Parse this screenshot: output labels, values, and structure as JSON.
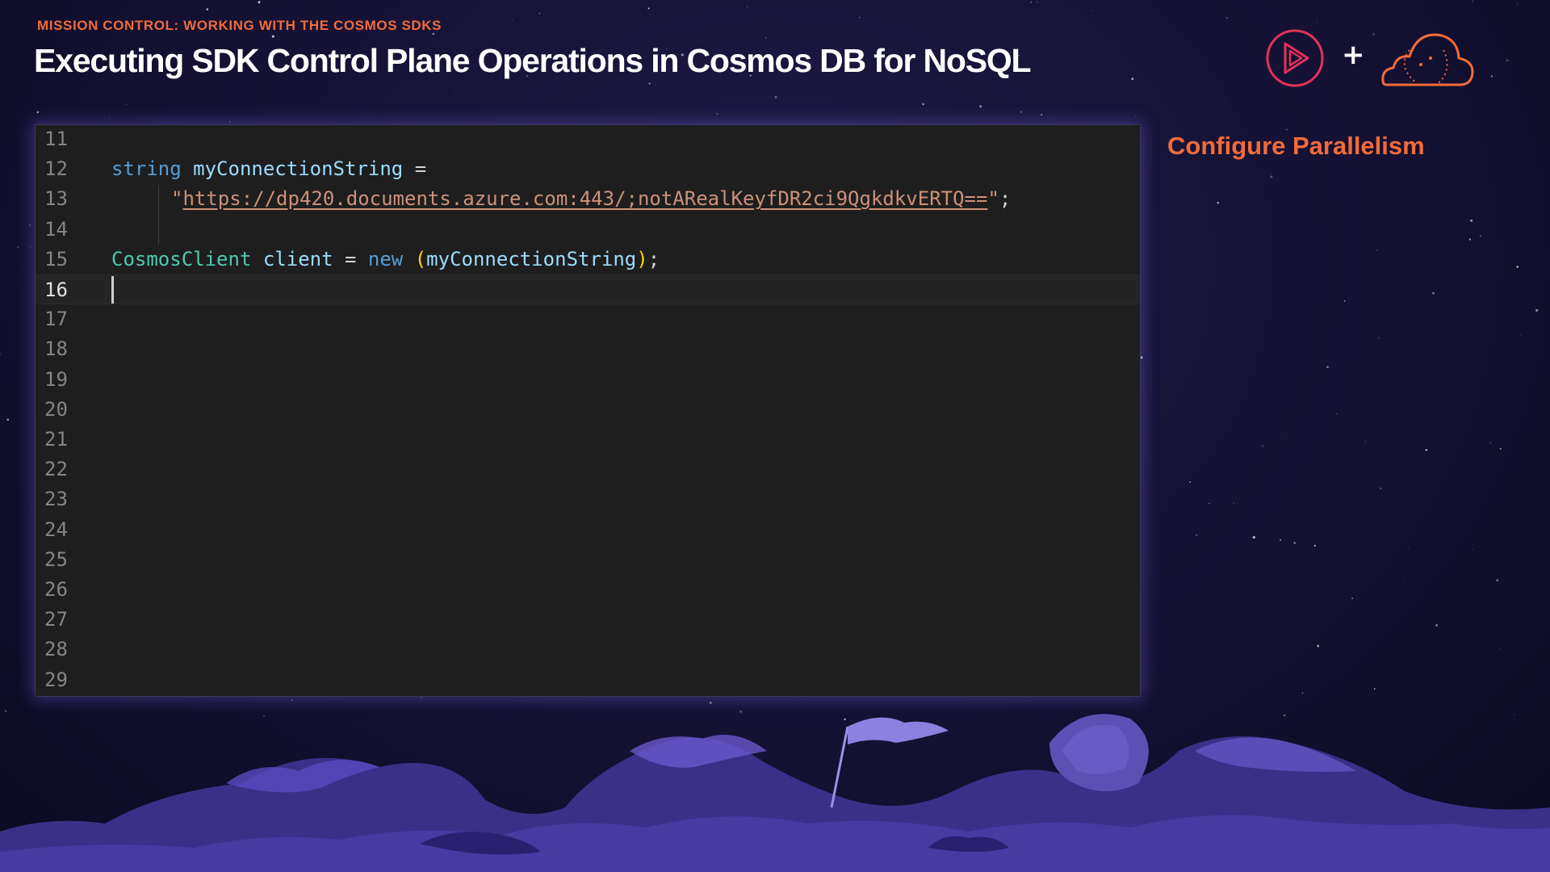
{
  "slide": {
    "kicker": "MISSION CONTROL: WORKING WITH THE COSMOS SDKS",
    "title": "Executing SDK Control Plane Operations in Cosmos DB for NoSQL",
    "side_heading": "Configure Parallelism",
    "plus_sign": "+"
  },
  "brand": {
    "play_logo_icon": "play-logo-icon",
    "cloud_logo_icon": "cloud-logo-icon",
    "accent_color": "#f26b3a"
  },
  "editor": {
    "current_line": "16",
    "lines": [
      {
        "num": "11",
        "code": ""
      },
      {
        "num": "12",
        "tokens": [
          {
            "t": "string",
            "c": "kw"
          },
          {
            "t": " ",
            "c": "plain"
          },
          {
            "t": "myConnectionString",
            "c": "var"
          },
          {
            "t": " =",
            "c": "plain"
          }
        ]
      },
      {
        "num": "13",
        "tokens": [
          {
            "t": "\"",
            "c": "str"
          },
          {
            "t": "https://dp420.documents.azure.com:443/;notARealKeyfDR2ci9QgkdkvERTQ==",
            "c": "strurl"
          },
          {
            "t": "\"",
            "c": "str"
          },
          {
            "t": ";",
            "c": "plain"
          }
        ]
      },
      {
        "num": "14",
        "code": ""
      },
      {
        "num": "15",
        "tokens": [
          {
            "t": "CosmosClient",
            "c": "type"
          },
          {
            "t": " ",
            "c": "plain"
          },
          {
            "t": "client",
            "c": "var"
          },
          {
            "t": " = ",
            "c": "plain"
          },
          {
            "t": "new",
            "c": "kw"
          },
          {
            "t": " ",
            "c": "plain"
          },
          {
            "t": "(",
            "c": "paren"
          },
          {
            "t": "myConnectionString",
            "c": "var"
          },
          {
            "t": ")",
            "c": "paren"
          },
          {
            "t": ";",
            "c": "plain"
          }
        ]
      },
      {
        "num": "16",
        "code": ""
      },
      {
        "num": "17",
        "code": ""
      },
      {
        "num": "18",
        "code": ""
      },
      {
        "num": "19",
        "code": ""
      },
      {
        "num": "20",
        "code": ""
      },
      {
        "num": "21",
        "code": ""
      },
      {
        "num": "22",
        "code": ""
      },
      {
        "num": "23",
        "code": ""
      },
      {
        "num": "24",
        "code": ""
      },
      {
        "num": "25",
        "code": ""
      },
      {
        "num": "26",
        "code": ""
      },
      {
        "num": "27",
        "code": ""
      },
      {
        "num": "28",
        "code": ""
      },
      {
        "num": "29",
        "code": ""
      }
    ]
  }
}
